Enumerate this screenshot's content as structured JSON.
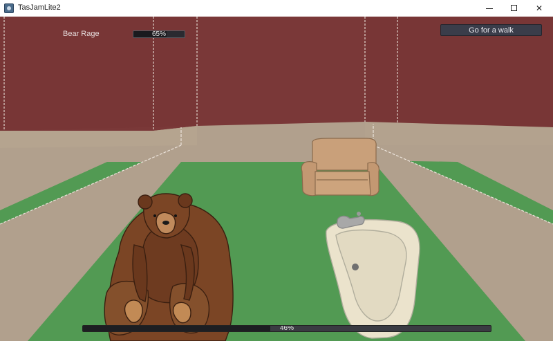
{
  "window": {
    "title": "TasJamLite2",
    "minimize_glyph": "",
    "maximize_glyph": "",
    "close_glyph": "✕"
  },
  "hud": {
    "rage_label": "Bear Rage",
    "rage_value": 0.65,
    "rage_text": "65%",
    "walk_button": "Go for a walk",
    "progress_value": 0.46,
    "progress_text": "46%"
  },
  "colors": {
    "wall": "#7a3838",
    "floor_border": "#b1a08d",
    "carpet": "#529a53",
    "bear_fur": "#7b4525",
    "armchair": "#c9a07a",
    "bathtub": "#ebe3cc"
  },
  "icons": {
    "app": "app-icon",
    "minimize": "minimize-icon",
    "maximize": "maximize-icon",
    "close": "close-icon"
  }
}
